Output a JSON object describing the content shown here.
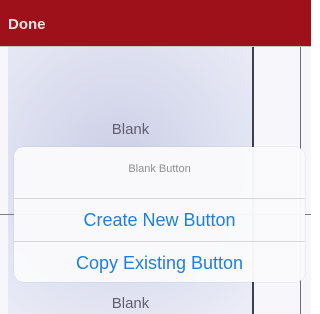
{
  "nav": {
    "done_label": "Done"
  },
  "tiles": {
    "top_label": "Blank",
    "bottom_label": "Blank"
  },
  "sheet": {
    "title": "Blank Button",
    "actions": [
      "Create New Button",
      "Copy Existing Button"
    ]
  }
}
